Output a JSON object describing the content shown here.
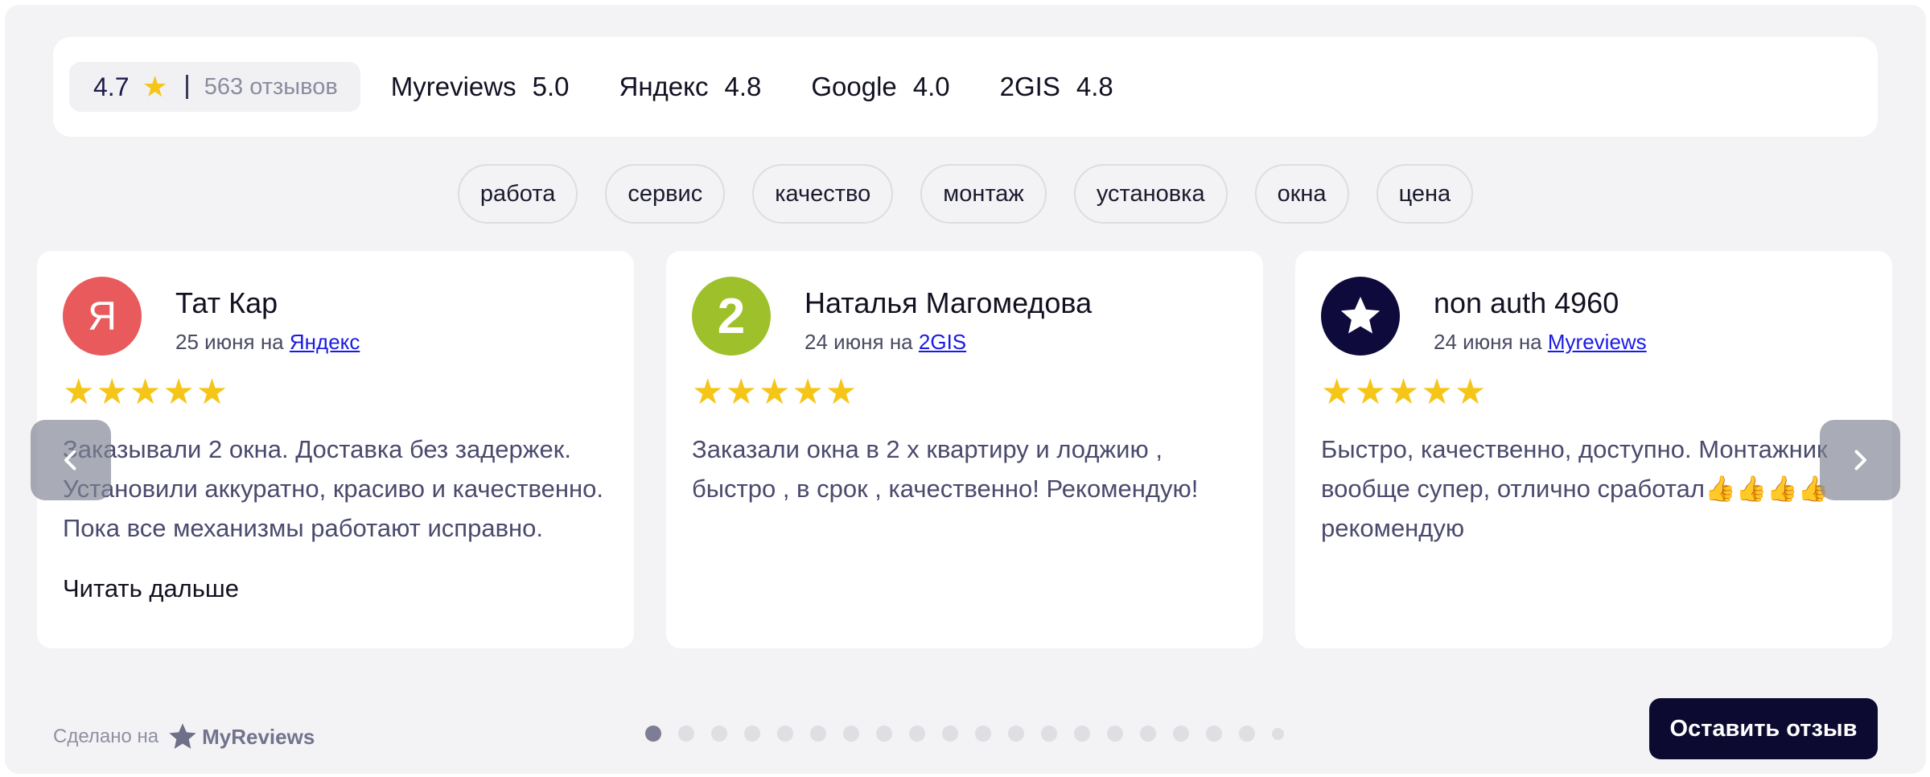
{
  "summary": {
    "score": "4.7",
    "count": "563 отзывов",
    "star_color": "#f5c518"
  },
  "sources": [
    {
      "name": "Myreviews",
      "score": "5.0"
    },
    {
      "name": "Яндекс",
      "score": "4.8"
    },
    {
      "name": "Google",
      "score": "4.0"
    },
    {
      "name": "2GIS",
      "score": "4.8"
    }
  ],
  "tags": [
    "работа",
    "сервис",
    "качество",
    "монтаж",
    "установка",
    "окна",
    "цена"
  ],
  "reviews": [
    {
      "avatar_icon": "yandex-logo-icon",
      "avatar_letter": "Я",
      "author": "Тат Кар",
      "date": "25 июня на",
      "source": "Яндекс",
      "stars": "★★★★★",
      "text": "Заказывали 2 окна. Доставка без задержек. Установили аккуратно, красиво и качественно. Пока все механизмы работают исправно.",
      "read_more": "Читать дальше"
    },
    {
      "avatar_icon": "2gis-logo-icon",
      "avatar_letter": "2",
      "author": "Наталья Магомедова",
      "date": "24 июня на",
      "source": "2GIS",
      "stars": "★★★★★",
      "text": "Заказали окна в 2 х квартиру и лоджию , быстро , в срок , качественно! Рекомендую!"
    },
    {
      "avatar_icon": "myreviews-star-icon",
      "author": "non auth 4960",
      "date": "24 июня на",
      "source": "Myreviews",
      "stars": "★★★★★",
      "text": "Быстро, качественно, доступно. Монтажник вообще супер, отлично сработал👍👍👍👍рекомендую"
    }
  ],
  "footer": {
    "made_on": "Сделано на",
    "brand": "MyReviews",
    "leave_review": "Оставить отзыв",
    "pagination_total": 20,
    "pagination_active": 1
  },
  "colors": {
    "accent_dark": "#0c0a30",
    "background": "#f3f3f6",
    "yandex": "#e85a5c",
    "twogis": "#9ec12b",
    "myreviews": "#0e0b3c"
  }
}
